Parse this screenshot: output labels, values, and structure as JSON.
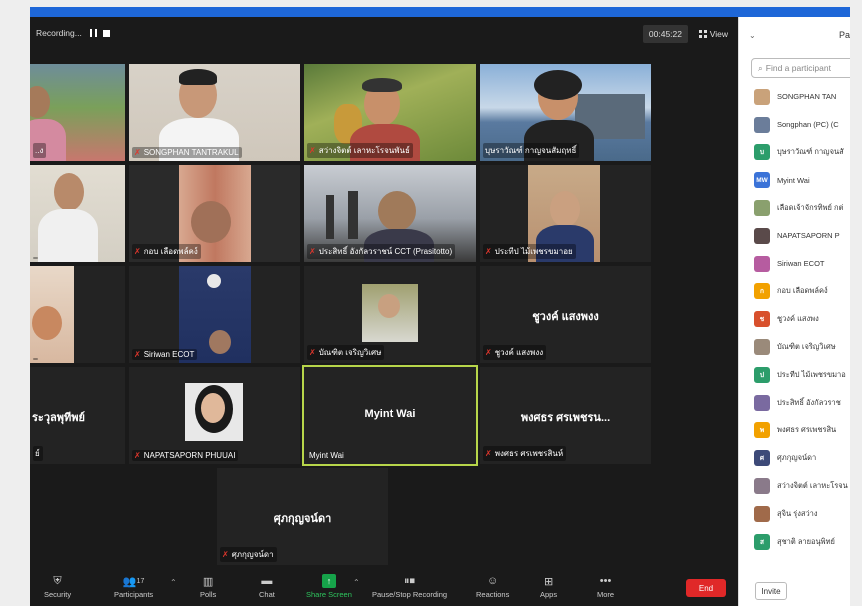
{
  "recording": {
    "label": "Recording..."
  },
  "timer": "00:45:22",
  "view_label": "View",
  "tiles": [
    {
      "name": "..ง",
      "center": ""
    },
    {
      "name": "SONGPHAN TANTRAKUL",
      "center": ""
    },
    {
      "name": "สว่างจิตต์ เลาหะโรจนพันธ์",
      "center": ""
    },
    {
      "name": "บุษราวัณฑ์ กาญจนสัมฤทธิ์",
      "center": ""
    },
    {
      "name": "",
      "center": ""
    },
    {
      "name": "กอบ เลือดพล์คง์",
      "center": ""
    },
    {
      "name": "ประสิทธิ์ อังกัลวราชน์ CCT (Prasitotto)",
      "center": ""
    },
    {
      "name": "ประทีป ไม้เพชรขมาอย",
      "center": ""
    },
    {
      "name": "",
      "center": ""
    },
    {
      "name": "Siriwan ECOT",
      "center": ""
    },
    {
      "name": "บัณฑิต เจริญวิเศษ",
      "center": ""
    },
    {
      "name": "ชูวงค์ แสงพงง",
      "center": "ชูวงค์ แสงพงง"
    },
    {
      "name": "ย์",
      "center": "ระวุลพุทีพย์"
    },
    {
      "name": "NAPATSAPORN PHUUAI",
      "center": ""
    },
    {
      "name": "Myint Wai",
      "center": "Myint Wai"
    },
    {
      "name": "พงศธร ศรเพชรสินห์",
      "center": "พงศธร ศรเพชรน..."
    },
    {
      "name": "ศุภกุญจน์ดา",
      "center": "ศุภกุญจน์ดา"
    }
  ],
  "toolbar": {
    "security": "Security",
    "participants": "Participants",
    "participants_count": "17",
    "polls": "Polls",
    "chat": "Chat",
    "share": "Share Screen",
    "pause_stop": "Pause/Stop Recording",
    "reactions": "Reactions",
    "apps": "Apps",
    "more": "More",
    "end": "End"
  },
  "panel": {
    "title": "Pa",
    "search_placeholder": "Find a participant",
    "participants": [
      {
        "name": "SONGPHAN TAN",
        "initials": "",
        "color": "#c9a27a"
      },
      {
        "name": "Songphan (PC) (C",
        "initials": "",
        "color": "#6b7d9a"
      },
      {
        "name": "บุษราวัณฑ์ กาญจนสั",
        "initials": "บ",
        "color": "#2c9d6b"
      },
      {
        "name": "Myint Wai",
        "initials": "MW",
        "color": "#3b73d8"
      },
      {
        "name": "เลือดเจ้าจักรทิพย์ กต่",
        "initials": "",
        "color": "#8aa06e"
      },
      {
        "name": "NAPATSAPORN P",
        "initials": "",
        "color": "#5a4a4a"
      },
      {
        "name": "Siriwan ECOT",
        "initials": "",
        "color": "#b65ca0"
      },
      {
        "name": "กอบ เลือดพล์คง์",
        "initials": "ก",
        "color": "#f2a100"
      },
      {
        "name": "ชูวงค์ แสงพง",
        "initials": "ช",
        "color": "#d8502c"
      },
      {
        "name": "บัณฑิต เจริญวิเศษ",
        "initials": "",
        "color": "#9a8a7a"
      },
      {
        "name": "ประทีป ไม้เพชรขมาอ",
        "initials": "ป",
        "color": "#2c9d6b"
      },
      {
        "name": "ประสิทธิ์ อังกัลวราช",
        "initials": "",
        "color": "#7a6aa0"
      },
      {
        "name": "พงศธร ศรเพชรสิน",
        "initials": "พ",
        "color": "#f2a100"
      },
      {
        "name": "ศุภกุญจน์ดา",
        "initials": "ศ",
        "color": "#3d4a78"
      },
      {
        "name": "สว่างจิตต์ เลาหะโรจน",
        "initials": "",
        "color": "#8a7a8a"
      },
      {
        "name": "สุจิน รุ่งสว่าง",
        "initials": "",
        "color": "#a06a4a"
      },
      {
        "name": "สุชาติ ลายอนุพิทย์",
        "initials": "ส",
        "color": "#2c9d6b"
      }
    ],
    "invite": "Invite"
  }
}
